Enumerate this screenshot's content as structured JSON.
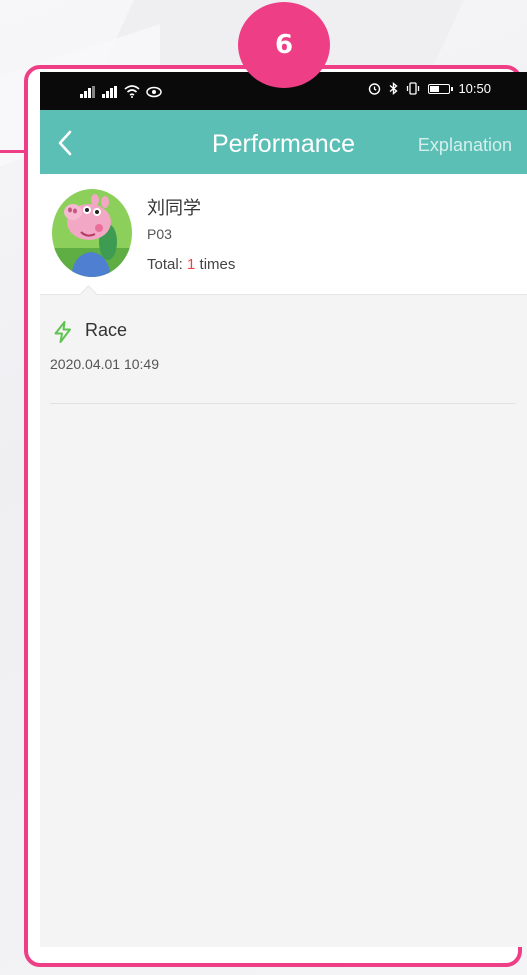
{
  "step_badge": "6",
  "status_bar": {
    "time": "10:50",
    "battery_level": 0.55,
    "icons": [
      "signal-icon",
      "signal-icon",
      "wifi-icon",
      "eye-icon",
      "alarm-icon",
      "bluetooth-icon",
      "vibrate-icon",
      "battery-icon"
    ]
  },
  "app_bar": {
    "back_icon": "chevron-left-icon",
    "title": "Performance",
    "explanation": "Explanation",
    "color": "#5cbfb6"
  },
  "profile": {
    "avatar_icon": "cartoon-pig-avatar",
    "name": "刘同学",
    "id": "P03",
    "total_prefix": "Total:",
    "total_count": "1",
    "total_suffix": "times"
  },
  "records": [
    {
      "icon": "lightning-icon",
      "title": "Race",
      "time": "2020.04.01 10:49"
    }
  ],
  "colors": {
    "accent": "#ee3f86",
    "lightning": "#5fc352",
    "count_highlight": "#e8453c"
  }
}
